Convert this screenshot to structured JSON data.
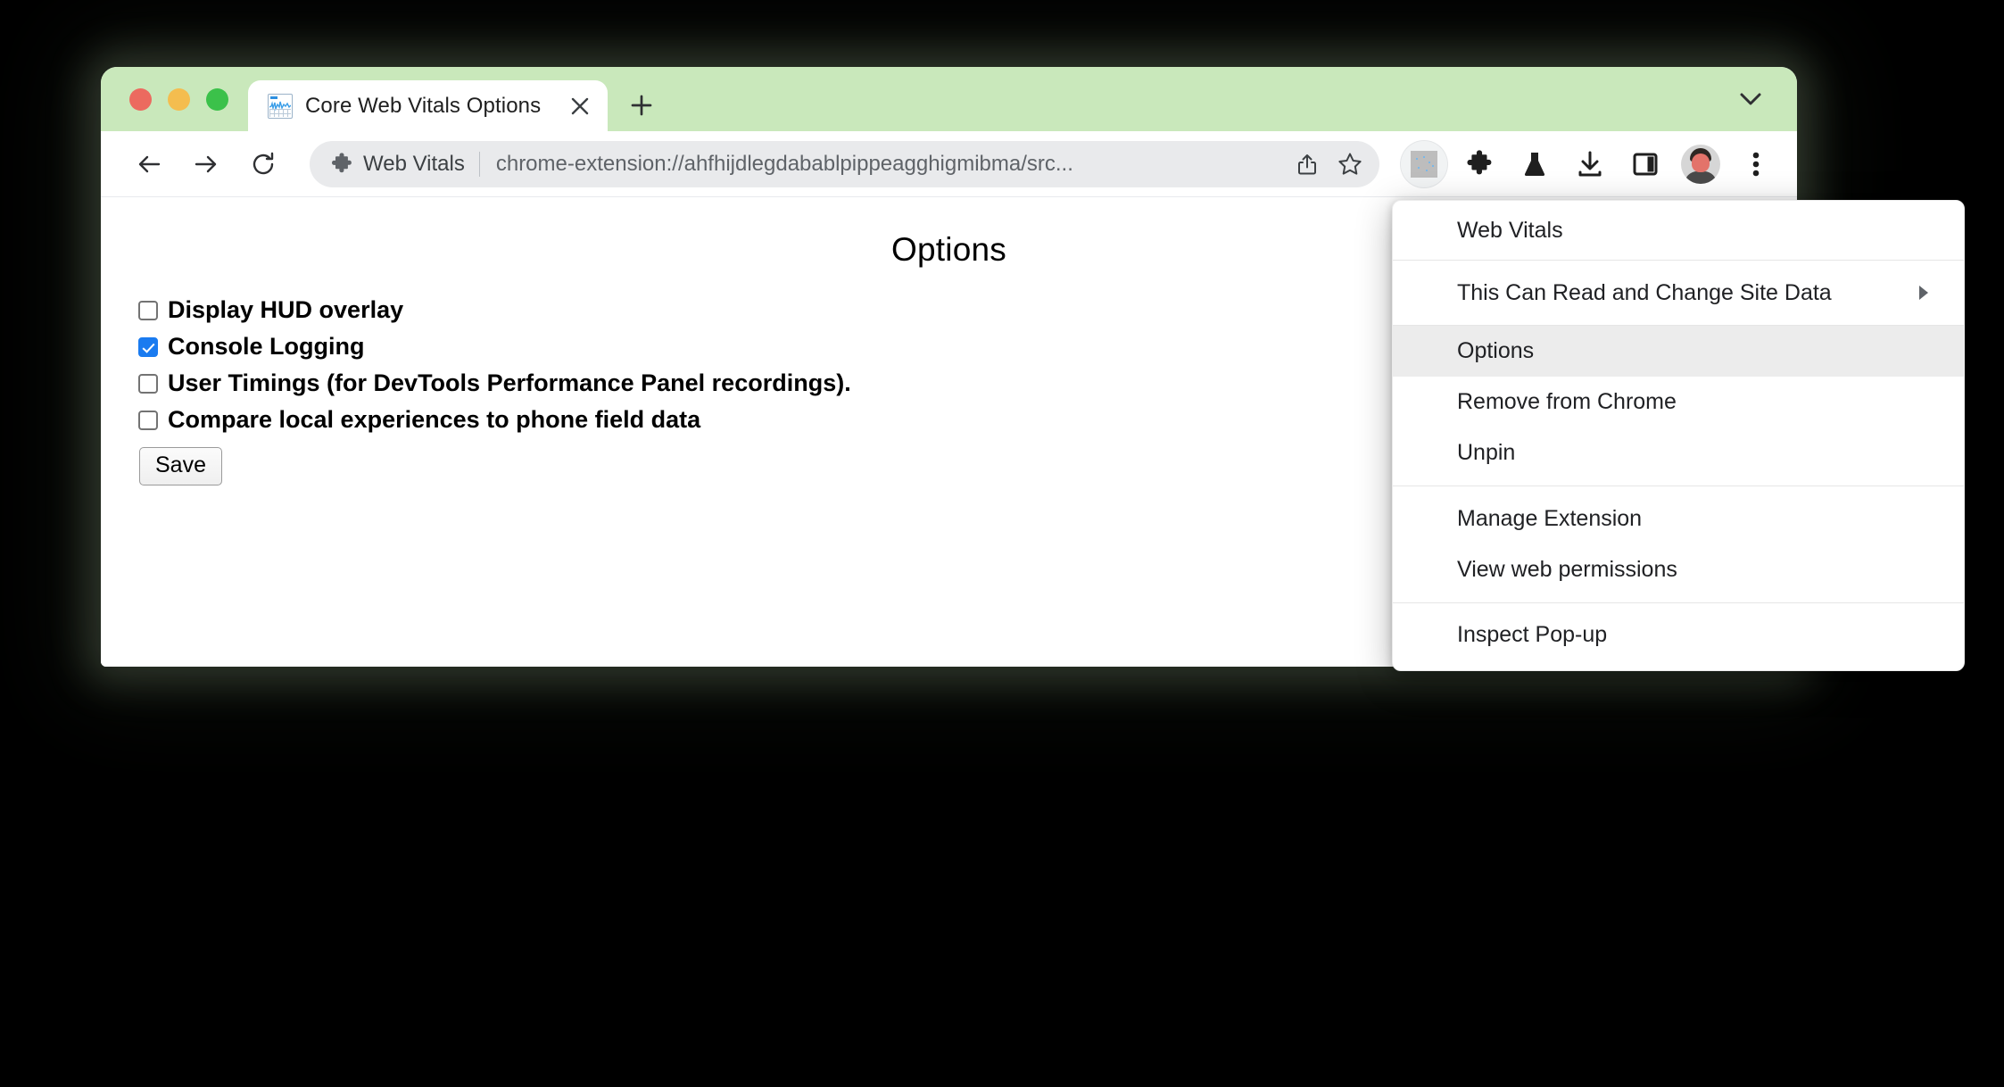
{
  "window": {
    "traffic_lights": [
      "close",
      "minimize",
      "maximize"
    ],
    "tab": {
      "title": "Core Web Vitals Options",
      "favicon": "web-vitals-chart-icon",
      "close_icon": "close-icon"
    },
    "new_tab_icon": "plus-icon",
    "tab_search_icon": "chevron-down-icon",
    "tabstrip_color": "#c9e8bb"
  },
  "toolbar": {
    "back_icon": "back-arrow-icon",
    "forward_icon": "forward-arrow-icon",
    "reload_icon": "reload-icon",
    "omnibox": {
      "extension_icon": "puzzle-piece-icon",
      "chip_label": "Web Vitals",
      "url": "chrome-extension://ahfhijdlegdabablpippeagghigmibma/src...",
      "share_icon": "share-icon",
      "bookmark_icon": "star-icon"
    },
    "actions": [
      {
        "name": "extension-web-vitals-icon",
        "label": "Web Vitals extension"
      },
      {
        "name": "extensions-puzzle-icon",
        "label": "Extensions"
      },
      {
        "name": "flask-icon",
        "label": "Experiments"
      },
      {
        "name": "download-icon",
        "label": "Downloads"
      },
      {
        "name": "side-panel-icon",
        "label": "Side panel"
      },
      {
        "name": "avatar",
        "label": "Profile"
      },
      {
        "name": "three-dot-menu-icon",
        "label": "Customize and control Chrome"
      }
    ]
  },
  "page": {
    "title": "Options",
    "options": [
      {
        "label": "Display HUD overlay",
        "checked": false
      },
      {
        "label": "Console Logging",
        "checked": true
      },
      {
        "label": "User Timings (for DevTools Performance Panel recordings).",
        "checked": false
      },
      {
        "label": "Compare local experiences to phone field data",
        "checked": false
      }
    ],
    "save_label": "Save"
  },
  "extension_menu": {
    "groups": [
      {
        "items": [
          {
            "label": "Web Vitals",
            "highlighted": false,
            "submenu": false
          }
        ]
      },
      {
        "items": [
          {
            "label": "This Can Read and Change Site Data",
            "highlighted": false,
            "submenu": true
          }
        ]
      },
      {
        "items": [
          {
            "label": "Options",
            "highlighted": true,
            "submenu": false
          },
          {
            "label": "Remove from Chrome",
            "highlighted": false,
            "submenu": false
          },
          {
            "label": "Unpin",
            "highlighted": false,
            "submenu": false
          }
        ]
      },
      {
        "items": [
          {
            "label": "Manage Extension",
            "highlighted": false,
            "submenu": false
          },
          {
            "label": "View web permissions",
            "highlighted": false,
            "submenu": false
          }
        ]
      },
      {
        "items": [
          {
            "label": "Inspect Pop-up",
            "highlighted": false,
            "submenu": false
          }
        ]
      }
    ]
  },
  "colors": {
    "tabstrip": "#c9e8bb",
    "checkbox_checked": "#1a7bf0",
    "menu_highlight": "#ececec",
    "omnibox_bg": "#e9eaec"
  }
}
